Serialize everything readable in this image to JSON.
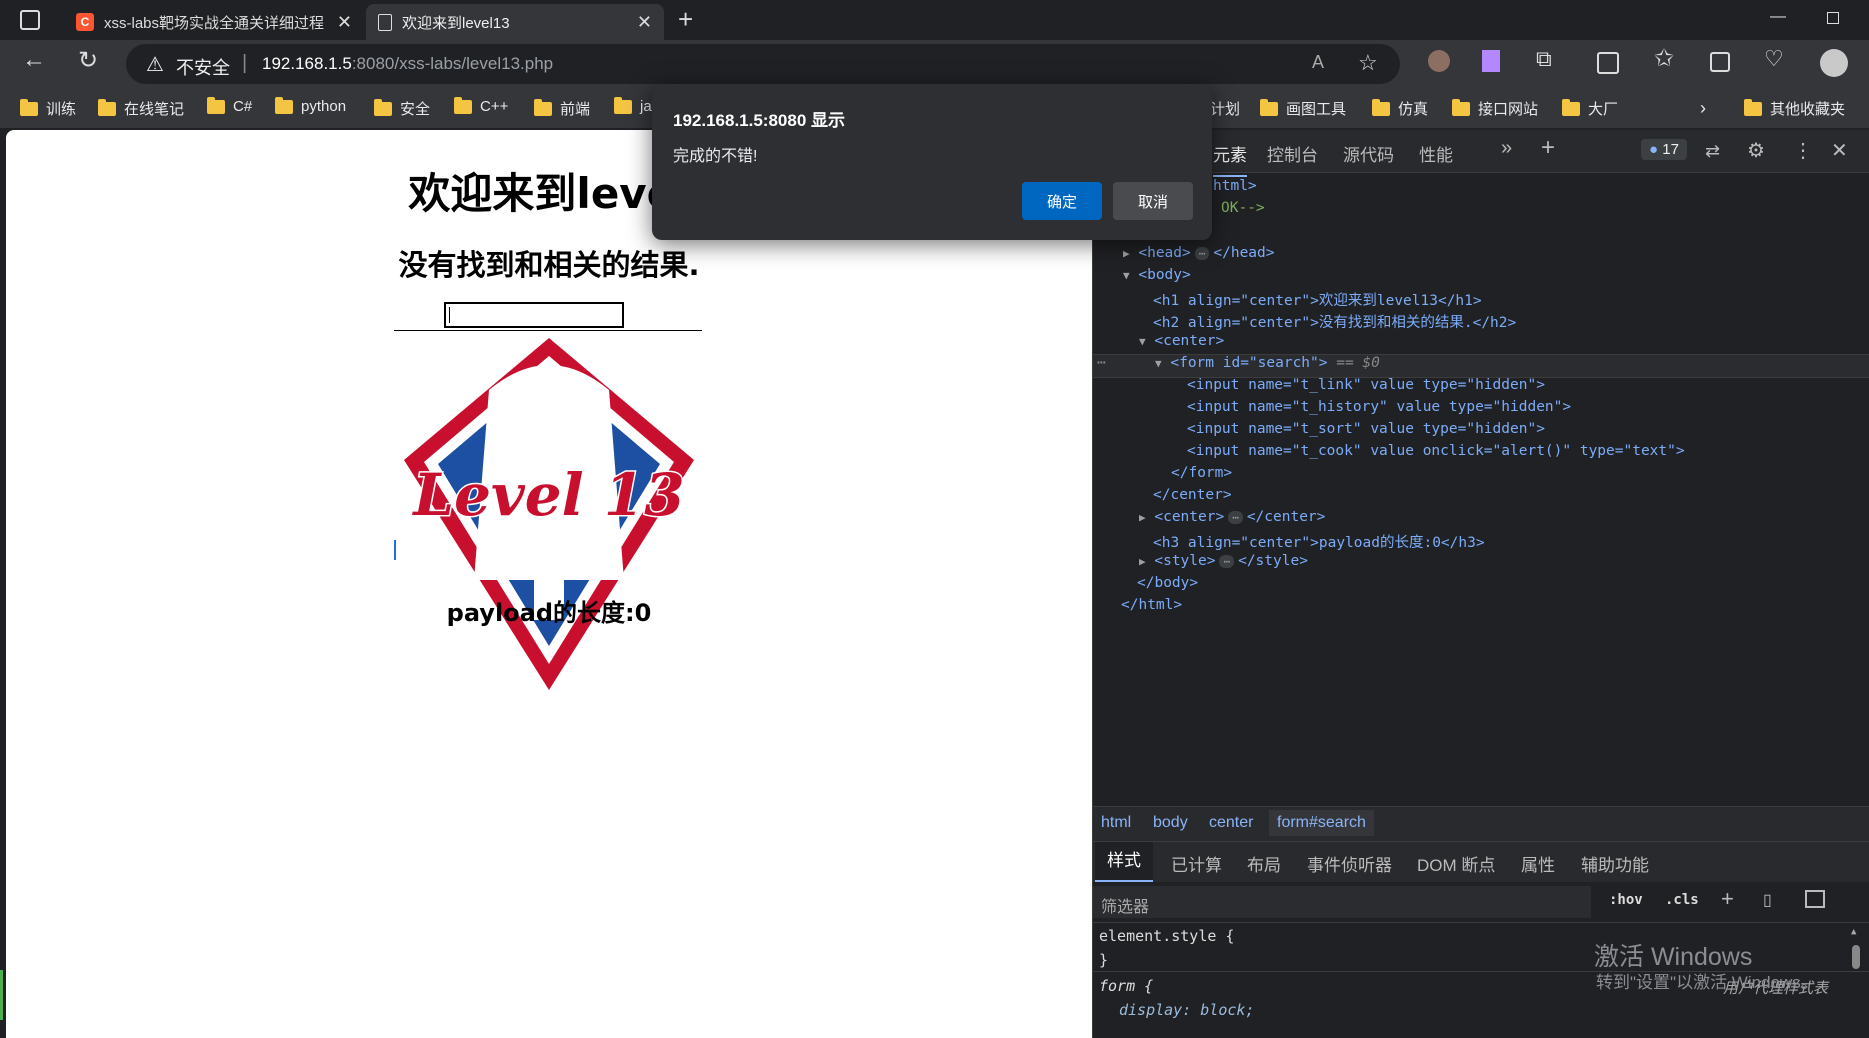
{
  "browser": {
    "tabs": [
      {
        "title": "xss-labs靶场实战全通关详细过程",
        "fav": "C"
      },
      {
        "title": "欢迎来到level13"
      }
    ],
    "address": {
      "security": "不安全",
      "url_host": "192.168.1.5",
      "url_rest": ":8080/xss-labs/level13.php"
    },
    "bookmarks": [
      "训练",
      "在线笔记",
      "C#",
      "python",
      "安全",
      "C++",
      "前端",
      "ja",
      "计划",
      "画图工具",
      "仿真",
      "接口网站",
      "大厂",
      "其他收藏夹"
    ]
  },
  "page": {
    "h1": "欢迎来到level",
    "h2": "没有找到和相关的结果.",
    "logo_text": "Level 13",
    "h3": "payload的长度:0"
  },
  "dialog": {
    "title": "192.168.1.5:8080 显示",
    "message": "完成的不错!",
    "ok": "确定",
    "cancel": "取消"
  },
  "devtools": {
    "tabs": [
      "元素",
      "控制台",
      "源代码",
      "性能"
    ],
    "issues_count": "17",
    "code_lines": [
      {
        "t": "html>"
      },
      {
        "t": "OK-->"
      },
      {
        "t": "<head>"
      },
      {
        "t": "</head>"
      },
      {
        "t": "<body>"
      },
      {
        "t": "<h1 align=\"center\">欢迎来到level13</h1>"
      },
      {
        "t": "<h2 align=\"center\">没有找到和相关的结果.</h2>"
      },
      {
        "t": "<center>"
      },
      {
        "t": "<form id=\"search\">"
      },
      {
        "t": "== $0"
      },
      {
        "t": "<input name=\"t_link\" value type=\"hidden\">"
      },
      {
        "t": "<input name=\"t_history\" value type=\"hidden\">"
      },
      {
        "t": "<input name=\"t_sort\" value type=\"hidden\">"
      },
      {
        "t": "<input name=\"t_cook\" value onclick=\"alert()\" type=\"text\">"
      },
      {
        "t": "</form>"
      },
      {
        "t": "</center>"
      },
      {
        "t": "<center>"
      },
      {
        "t": "</center>"
      },
      {
        "t": "<h3 align=\"center\">payload的长度:0</h3>"
      },
      {
        "t": "<style>"
      },
      {
        "t": "</style>"
      },
      {
        "t": "</body>"
      },
      {
        "t": "</html>"
      }
    ],
    "breadcrumbs": [
      "html",
      "body",
      "center",
      "form#search"
    ],
    "subtabs": [
      "样式",
      "已计算",
      "布局",
      "事件侦听器",
      "DOM 断点",
      "属性",
      "辅助功能"
    ],
    "filter_placeholder": "筛选器",
    "hov": ":hov",
    "cls": ".cls",
    "styles": [
      "element.style {",
      "}",
      "form {",
      "display: block;"
    ],
    "ua_label": "用户代理样式表"
  },
  "watermark": {
    "line1": "激活 Windows",
    "line2": "转到\"设置\"以激活 Windows。"
  }
}
